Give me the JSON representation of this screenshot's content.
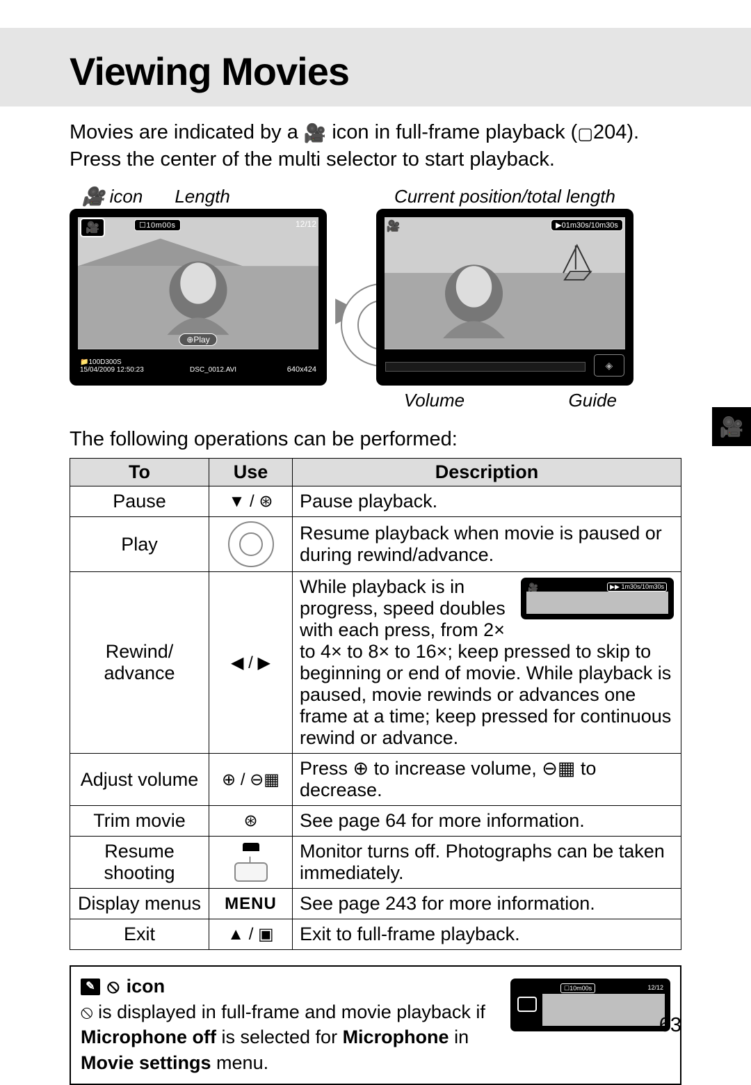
{
  "title": "Viewing Movies",
  "intro_part1": "Movies are indicated by a ",
  "intro_part2": " icon in full-frame playback (",
  "intro_page_ref": "204",
  "intro_part3": "). Press the center of the multi selector to start playback.",
  "labels": {
    "movie_icon": "icon",
    "length": "Length",
    "current_pos": "Current position/total length",
    "volume": "Volume",
    "guide": "Guide"
  },
  "screen1": {
    "length_text": "☐10m00s",
    "count": "12/12",
    "play_label": "⊕Play",
    "folder": "📁100D300S",
    "date": "15/04/2009  12:50:23",
    "file": "DSC_0012.AVI",
    "res": "640x424"
  },
  "screen2": {
    "time_text": "▶01m30s/10m30s"
  },
  "ops_intro": "The following operations can be performed:",
  "table": {
    "headers": {
      "to": "To",
      "use": "Use",
      "desc": "Description"
    },
    "rows": [
      {
        "to": "Pause",
        "use": "▼ / ⊛",
        "desc": "Pause playback."
      },
      {
        "to": "Play",
        "use": "selector",
        "desc": "Resume playback when movie is paused or during rewind/advance."
      },
      {
        "to": "Rewind/\nadvance",
        "use": "◀ / ▶",
        "desc_pre": "While playback is in progress, speed doubles",
        "desc_post": "with each press, from 2× to 4× to 8× to 16×; keep pressed to skip to beginning or end of movie.  While playback is paused, movie rewinds or advances one frame at a time; keep pressed for continuous rewind or advance.",
        "mini_time": "▶▶ 1m30s/10m30s"
      },
      {
        "to": "Adjust volume",
        "use": "⊕ / ⊖▦",
        "desc": "Press ⊕ to increase volume, ⊖▦ to decrease."
      },
      {
        "to": "Trim movie",
        "use": "⊛",
        "desc": "See page 64 for more information."
      },
      {
        "to": "Resume shooting",
        "use": "shutter",
        "desc": "Monitor turns off.  Photographs can be taken immediately."
      },
      {
        "to": "Display menus",
        "use": "MENU",
        "desc": "See page 243 for more information."
      },
      {
        "to": "Exit",
        "use": "▲ / ▣",
        "desc": "Exit to full-frame playback."
      }
    ]
  },
  "note": {
    "head": "icon",
    "body_pre": " is displayed in full-frame and movie playback if ",
    "body_bold1": "Microphone off",
    "body_mid": " is selected for ",
    "body_bold2": "Microphone",
    "body_mid2": " in ",
    "body_bold3": "Movie settings",
    "body_end": " menu.",
    "mini_len": "☐10m00s",
    "mini_cnt": "12/12"
  },
  "page_number": "63",
  "icons": {
    "movie": "🎥",
    "page": "▢",
    "mic_off": "⦸"
  }
}
